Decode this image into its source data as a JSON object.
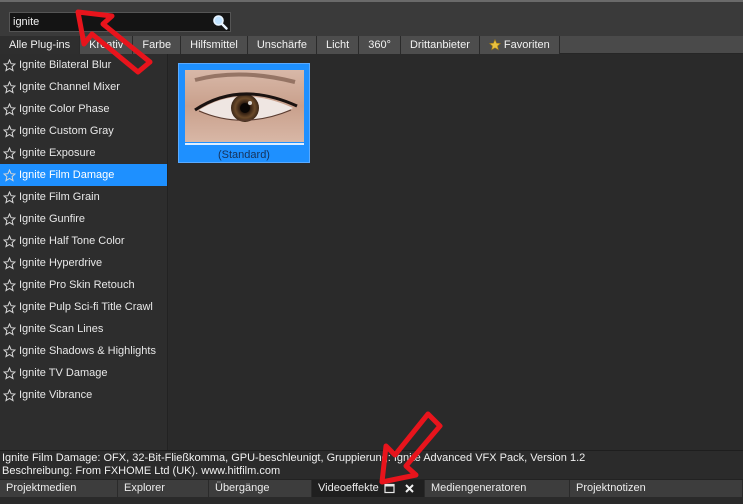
{
  "search": {
    "value": "ignite",
    "icon": "search-icon"
  },
  "tabs": [
    {
      "label": "Alle Plug-ins",
      "active": true
    },
    {
      "label": "Kreativ"
    },
    {
      "label": "Farbe"
    },
    {
      "label": "Hilfsmittel"
    },
    {
      "label": "Unschärfe"
    },
    {
      "label": "Licht"
    },
    {
      "label": "360°"
    },
    {
      "label": "Drittanbieter"
    },
    {
      "label": "Favoriten",
      "icon": "star-filled-icon"
    }
  ],
  "effects": [
    {
      "label": "Ignite Bilateral Blur"
    },
    {
      "label": "Ignite Channel Mixer"
    },
    {
      "label": "Ignite Color Phase"
    },
    {
      "label": "Ignite Custom Gray"
    },
    {
      "label": "Ignite Exposure"
    },
    {
      "label": "Ignite Film Damage",
      "selected": true
    },
    {
      "label": "Ignite Film Grain"
    },
    {
      "label": "Ignite Gunfire"
    },
    {
      "label": "Ignite Half Tone Color"
    },
    {
      "label": "Ignite Hyperdrive"
    },
    {
      "label": "Ignite Pro Skin Retouch"
    },
    {
      "label": "Ignite Pulp Sci-fi Title Crawl"
    },
    {
      "label": "Ignite Scan Lines"
    },
    {
      "label": "Ignite Shadows & Highlights"
    },
    {
      "label": "Ignite TV Damage"
    },
    {
      "label": "Ignite Vibrance"
    }
  ],
  "preset": {
    "caption": "(Standard)"
  },
  "status": {
    "line1": "Ignite Film Damage: OFX, 32-Bit-Fließkomma, GPU-beschleunigt, Gruppierung: Ignite Advanced VFX Pack, Version 1.2",
    "line2": "Beschreibung: From FXHOME Ltd (UK). www.hitfilm.com"
  },
  "bottom_tabs": [
    {
      "label": "Projektmedien",
      "width": 118
    },
    {
      "label": "Explorer",
      "width": 91
    },
    {
      "label": "Übergänge",
      "width": 103
    },
    {
      "label": "Videoeffekte",
      "width": 113,
      "active": true
    },
    {
      "label": "Mediengeneratoren",
      "width": 145
    },
    {
      "label": "Projektnotizen",
      "width": 173
    }
  ],
  "colors": {
    "selection": "#1e90ff",
    "arrow": "#e8141c"
  }
}
